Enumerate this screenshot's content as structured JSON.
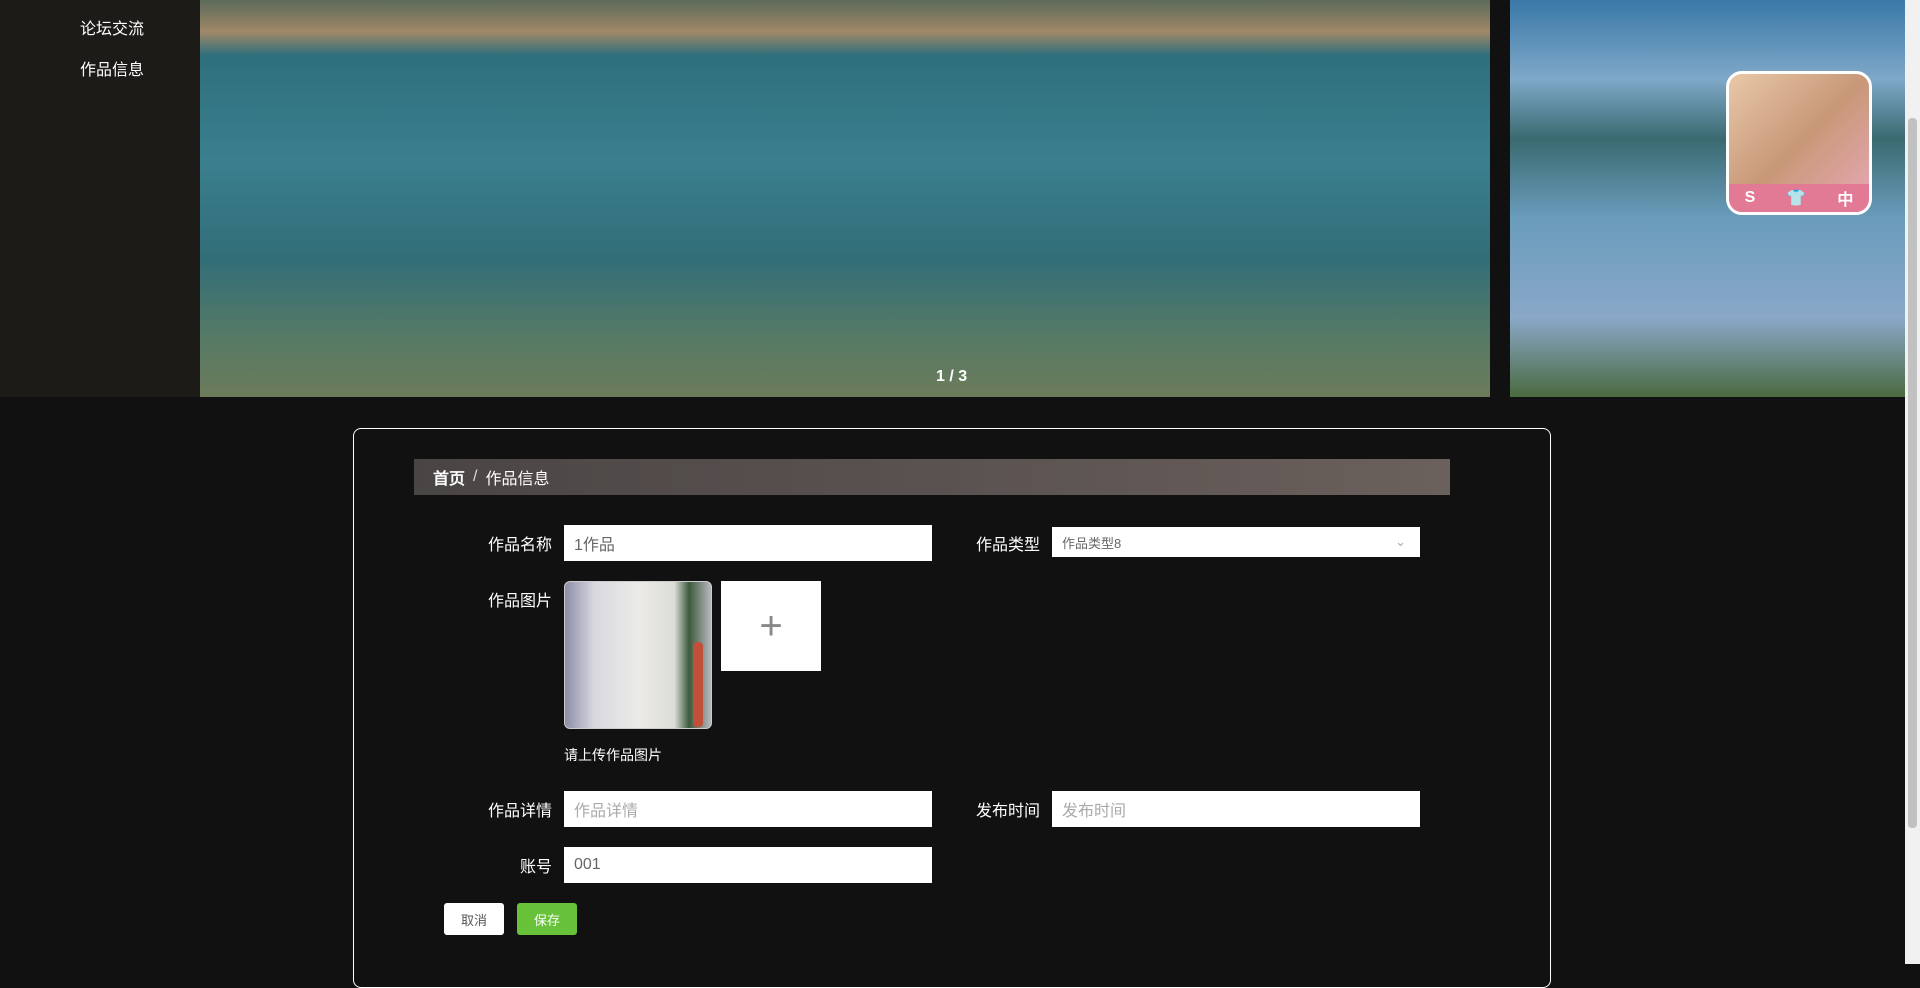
{
  "sidebar": {
    "items": [
      {
        "label": "论坛交流"
      },
      {
        "label": "作品信息"
      }
    ]
  },
  "carousel": {
    "indicator": "1 / 3"
  },
  "floating_avatar": {
    "badge": [
      "S",
      "👕",
      "中"
    ]
  },
  "breadcrumb": {
    "home": "首页",
    "separator": "/",
    "current": "作品信息"
  },
  "form": {
    "name": {
      "label": "作品名称",
      "value": "1作品"
    },
    "type": {
      "label": "作品类型",
      "value": "作品类型8"
    },
    "image": {
      "label": "作品图片",
      "hint": "请上传作品图片",
      "add_icon": "plus-icon"
    },
    "detail": {
      "label": "作品详情",
      "placeholder": "作品详情"
    },
    "publish_time": {
      "label": "发布时间",
      "placeholder": "发布时间"
    },
    "account": {
      "label": "账号",
      "value": "001"
    },
    "cancel_label": "取消",
    "save_label": "保存"
  },
  "colors": {
    "save": "#67c23a",
    "background": "#111111"
  }
}
